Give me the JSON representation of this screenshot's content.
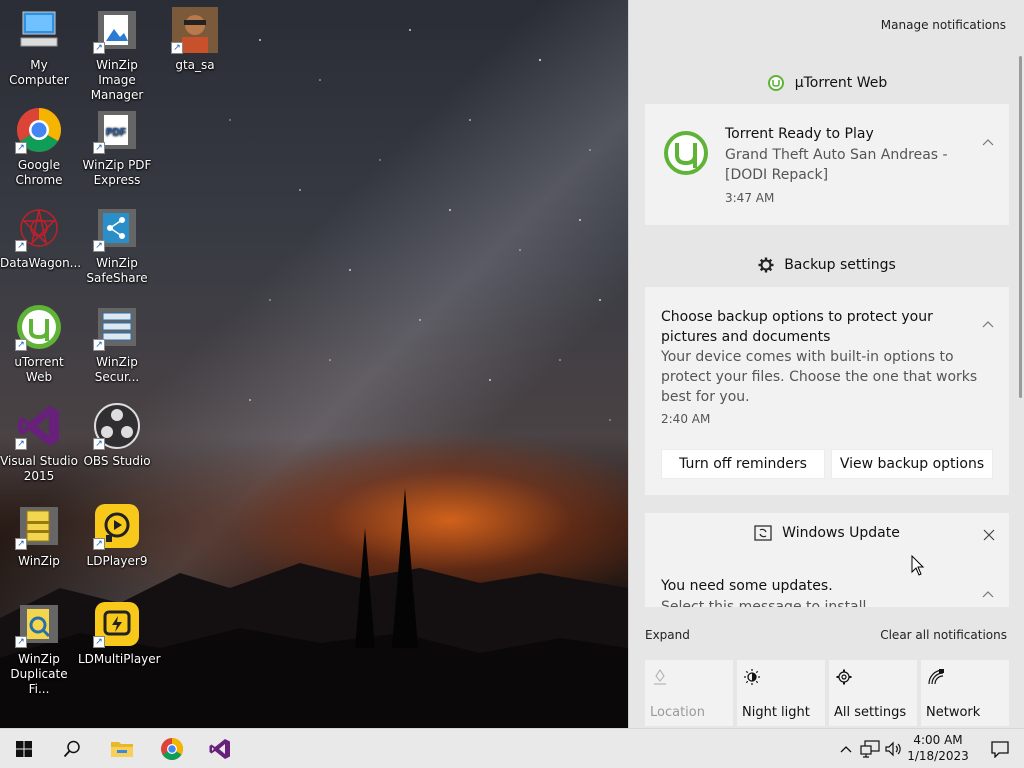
{
  "desktop": {
    "icons": [
      {
        "label": "My Computer",
        "icon": "my-computer-icon"
      },
      {
        "label": "WinZip Image Manager",
        "icon": "winzip-image-manager-icon"
      },
      {
        "label": "gta_sa",
        "icon": "gta-sa-icon"
      },
      {
        "label": "Google Chrome",
        "icon": "chrome-icon"
      },
      {
        "label": "WinZip PDF Express",
        "icon": "winzip-pdf-icon"
      },
      {
        "label": "DataWagon...",
        "icon": "datawagon-icon"
      },
      {
        "label": "WinZip SafeShare",
        "icon": "winzip-safeshare-icon"
      },
      {
        "label": "uTorrent Web",
        "icon": "utorrent-icon"
      },
      {
        "label": "WinZip Secur...",
        "icon": "winzip-secure-icon"
      },
      {
        "label": "Visual Studio 2015",
        "icon": "visual-studio-icon"
      },
      {
        "label": "OBS Studio",
        "icon": "obs-icon"
      },
      {
        "label": "WinZip",
        "icon": "winzip-icon"
      },
      {
        "label": "LDPlayer9",
        "icon": "ldplayer-icon"
      },
      {
        "label": "WinZip Duplicate Fi...",
        "icon": "winzip-duplicate-icon"
      },
      {
        "label": "LDMultiPlayer",
        "icon": "ldmultiplayer-icon"
      }
    ]
  },
  "action_center": {
    "manage_label": "Manage notifications",
    "groups": {
      "utorrent": {
        "header": "µTorrent Web",
        "title": "Torrent Ready to Play",
        "body": "Grand Theft Auto San Andreas - [DODI Repack]",
        "time": "3:47 AM"
      },
      "backup": {
        "header": "Backup settings",
        "title": "Choose backup options to protect your pictures and documents",
        "body": "Your device comes with built-in options to protect your files. Choose the one that works best for you.",
        "time": "2:40 AM",
        "button_left": "Turn off reminders",
        "button_right": "View backup options"
      },
      "update": {
        "header": "Windows Update",
        "title": "You need some updates.",
        "body": "Select this message to install..."
      }
    },
    "expand_label": "Expand",
    "clear_label": "Clear all notifications",
    "quick_actions": [
      {
        "label": "Location",
        "icon": "location-icon",
        "enabled": false
      },
      {
        "label": "Night light",
        "icon": "night-light-icon",
        "enabled": true
      },
      {
        "label": "All settings",
        "icon": "settings-gear-icon",
        "enabled": true
      },
      {
        "label": "Network",
        "icon": "network-icon",
        "enabled": true
      }
    ]
  },
  "taskbar": {
    "clock_time": "4:00 AM",
    "clock_date": "1/18/2023"
  },
  "colors": {
    "utorrent_green": "#5fb336",
    "vs_purple": "#68217a",
    "taskbar_bg": "#e9e9e9",
    "action_center_bg": "#e6e6e6"
  }
}
